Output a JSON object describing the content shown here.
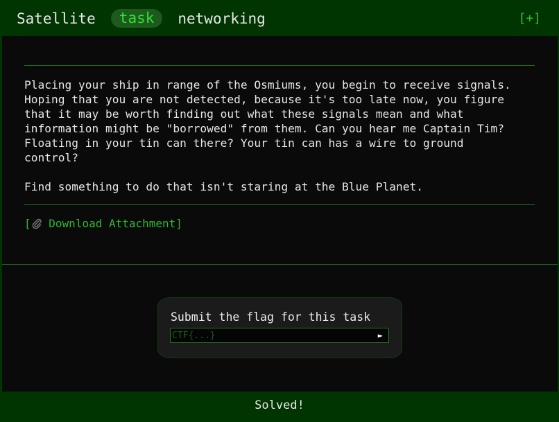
{
  "header": {
    "title_word_1": "Satellite",
    "title_word_2": "task",
    "title_word_3": "networking",
    "expand_label": "[+]"
  },
  "task": {
    "description": "Placing your ship in range of the Osmiums, you begin to receive signals.\nHoping that you are not detected, because it's too late now, you figure\nthat it may be worth finding out what these signals mean and what\ninformation might be \"borrowed\" from them. Can you hear me Captain Tim?\nFloating in your tin can there? Your tin can has a wire to ground\ncontrol?\n\nFind something to do that isn't staring at the Blue Planet.",
    "attachment": {
      "open_bracket": "[",
      "icon": "paperclip-icon",
      "label": "Download Attachment]"
    }
  },
  "submit": {
    "label": "Submit the flag for this task",
    "placeholder": "CTF{...}",
    "value": "",
    "button_glyph": "►"
  },
  "footer": {
    "status": "Solved!"
  },
  "colors": {
    "frame_green": "#003400",
    "accent_green": "#2fb82f",
    "panel_black": "#0a0a0a"
  }
}
